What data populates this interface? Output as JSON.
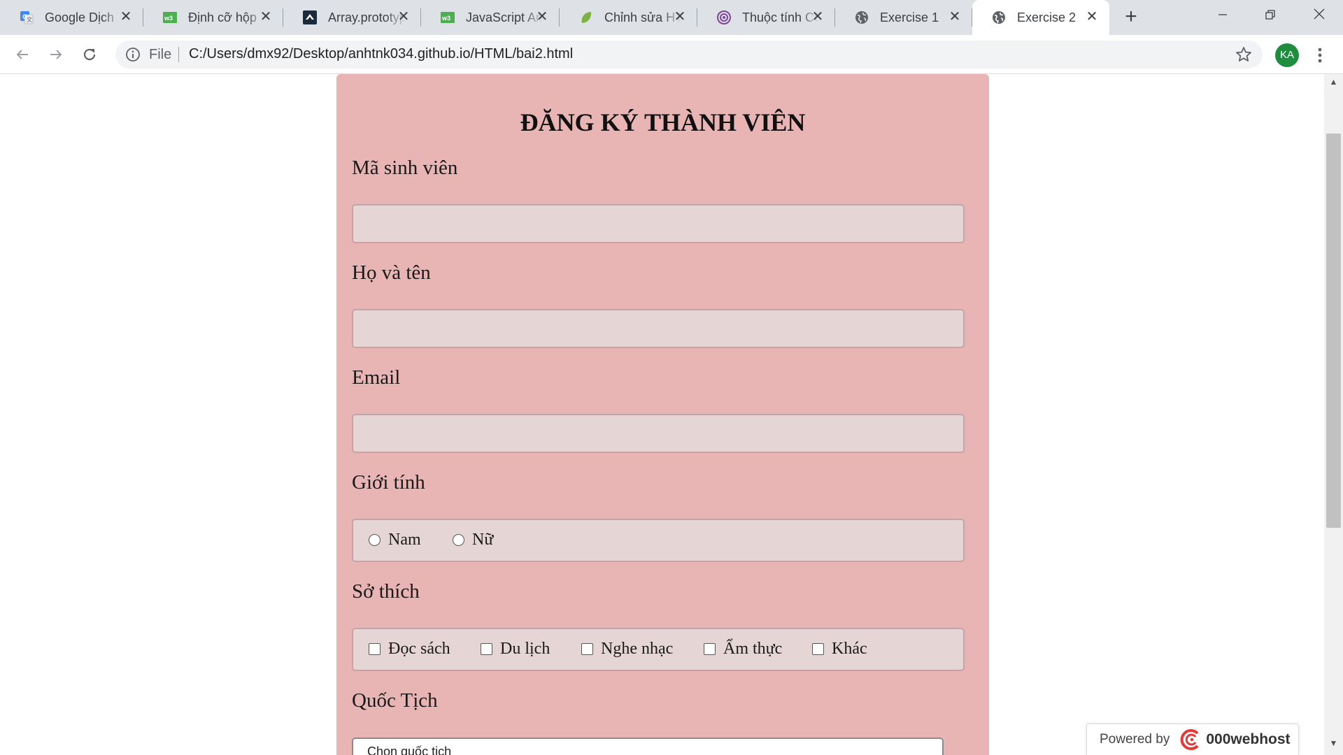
{
  "browser": {
    "tabs": [
      {
        "title": "Google Dịch",
        "icon": "google-translate-icon",
        "active": false
      },
      {
        "title": "Định cỡ hộp",
        "icon": "w3schools-icon",
        "active": false
      },
      {
        "title": "Array.prototype",
        "icon": "mdn-icon",
        "active": false
      },
      {
        "title": "JavaScript Array",
        "icon": "w3schools-icon",
        "active": false
      },
      {
        "title": "Chỉnh sửa HTML",
        "icon": "leaf-icon",
        "active": false
      },
      {
        "title": "Thuộc tính CSS",
        "icon": "tor-icon",
        "active": false
      },
      {
        "title": "Exercise 1",
        "icon": "globe-icon",
        "active": false
      },
      {
        "title": "Exercise 2",
        "icon": "globe-icon",
        "active": true
      }
    ],
    "address": {
      "scheme_label": "File",
      "url": "C:/Users/dmx92/Desktop/anhtnk034.github.io/HTML/bai2.html"
    },
    "profile_initials": "KA",
    "colors": {
      "tab_strip": "#dee1e6",
      "avatar": "#1e8e3e"
    }
  },
  "form": {
    "title": "ĐĂNG KÝ THÀNH VIÊN",
    "background": "#e8b4b4",
    "student_id_label": "Mã sinh viên",
    "full_name_label": "Họ và tên",
    "email_label": "Email",
    "gender_label": "Giới tính",
    "gender_options": [
      "Nam",
      "Nữ"
    ],
    "hobbies_label": "Sở thích",
    "hobby_options": [
      "Đọc sách",
      "Du lịch",
      "Nghe nhạc",
      "Ẩm thực",
      "Khác"
    ],
    "nationality_label": "Quốc Tịch",
    "nationality_selected": "Chọn quốc tịch"
  },
  "badge": {
    "powered_by": "Powered by",
    "brand": "000webhost"
  }
}
